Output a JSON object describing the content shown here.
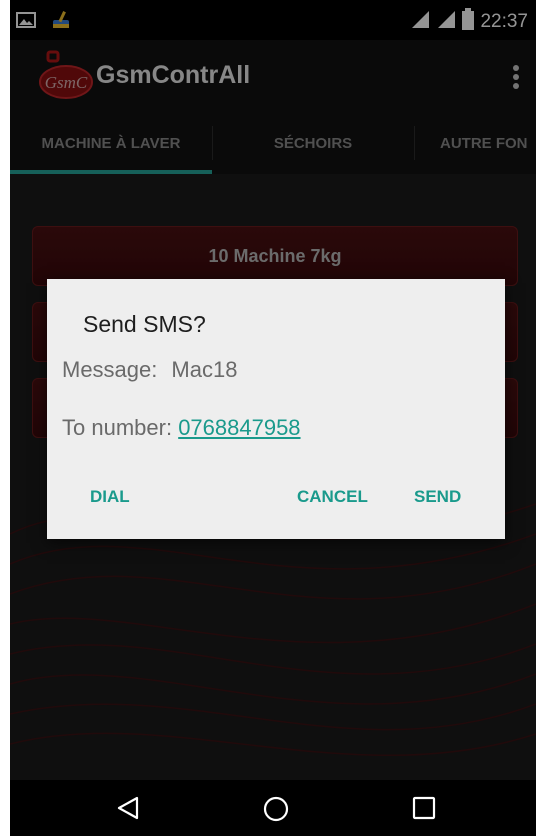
{
  "status_bar": {
    "time": "22:37",
    "icons": [
      "image-icon",
      "broom-icon",
      "signal-icon",
      "signal-icon",
      "battery-icon"
    ]
  },
  "app_bar": {
    "logo_text": "GsmC",
    "title": "GsmContrAll",
    "menu_icon": "overflow-menu-icon"
  },
  "tabs": [
    {
      "label": "MACHINE À LAVER",
      "selected": true
    },
    {
      "label": "SÉCHOIRS",
      "selected": false
    },
    {
      "label": "AUTRE FON",
      "selected": false
    }
  ],
  "machines": [
    {
      "label": "10 Machine 7kg"
    }
  ],
  "dialog": {
    "title": "Send SMS?",
    "message_label": "Message:",
    "message_value": "Mac18",
    "number_label": "To number:",
    "number_value": "0768847958",
    "buttons": {
      "dial": "DIAL",
      "cancel": "CANCEL",
      "send": "SEND"
    }
  },
  "colors": {
    "accent": "#26a69a",
    "dialog_link": "#1a9a8c",
    "button_red": "#4a1012"
  },
  "nav_bar": {
    "icons": [
      "back-icon",
      "home-icon",
      "recents-icon"
    ]
  }
}
